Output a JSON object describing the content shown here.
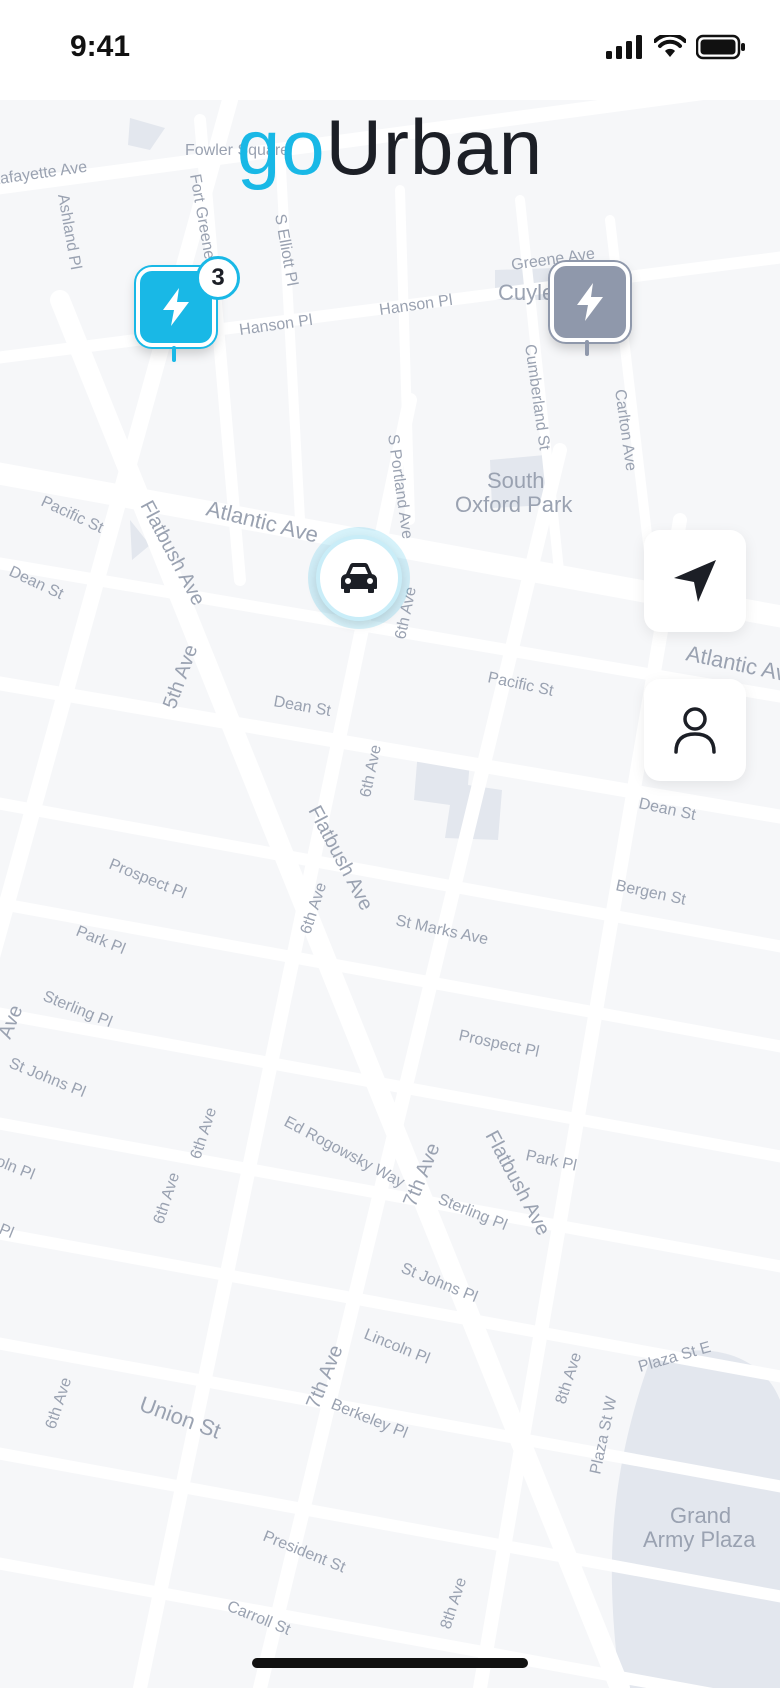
{
  "status_bar": {
    "time": "9:41"
  },
  "logo": {
    "go": "go",
    "urban": "Urban"
  },
  "map": {
    "street_labels": [
      "Fowler Square",
      "Lafayette Ave",
      "Fort Greene Pl",
      "Ashland Pl",
      "S Elliott Pl",
      "Hanson Pl",
      "Hanson Pl",
      "Greene Ave",
      "Cuyler",
      "Cumberland St",
      "Carlton Ave",
      "South",
      "Oxford Park",
      "S Portland Ave",
      "Atlantic Ave",
      "Atlantic Av",
      "Pacific St",
      "Pacific St",
      "Dean St",
      "Dean St",
      "Dean St",
      "Flatbush Ave",
      "Flatbush Ave",
      "Flatbush Ave",
      "5th Ave",
      "6th Ave",
      "6th Ave",
      "6th Ave",
      "6th Ave",
      "6th Ave",
      "6th Ave",
      "7th Ave",
      "7th Ave",
      "8th Ave",
      "8th Ave",
      "Bergen St",
      "St Marks Ave",
      "Prospect Pl",
      "Prospect Pl",
      "Park Pl",
      "Park Pl",
      "Sterling Pl",
      "Sterling Pl",
      "St Johns Pl",
      "St Johns Pl",
      "Ed Rogowsky Way",
      "Lincoln Pl",
      "Berkeley Pl",
      "Union St",
      "President St",
      "Carroll St",
      "Plaza St E",
      "Plaza St W",
      "Grand",
      "Army Plaza",
      "Ave",
      "oln Pl",
      "Pl"
    ]
  },
  "markers": {
    "charging_station_available": {
      "icon": "lightning-icon",
      "count": "3",
      "color": "#19b8e6"
    },
    "charging_station_unavailable": {
      "icon": "lightning-icon",
      "color": "#8f98ab"
    },
    "car": {
      "icon": "car-icon"
    }
  },
  "actions": {
    "locate": {
      "icon": "navigation-arrow-icon"
    },
    "profile": {
      "icon": "user-icon"
    }
  },
  "colors": {
    "accent": "#19b8e6",
    "dark": "#1c1f26",
    "inactive": "#8f98ab"
  }
}
